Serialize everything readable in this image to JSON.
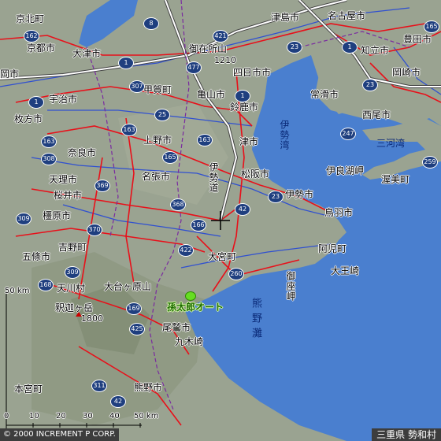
{
  "map": {
    "cities": [
      {
        "name": "京北町"
      },
      {
        "name": "京都市"
      },
      {
        "name": "大津市"
      },
      {
        "name": "宇治市"
      },
      {
        "name": "枚方市"
      },
      {
        "name": "奈良市"
      },
      {
        "name": "天理市"
      },
      {
        "name": "桜井市"
      },
      {
        "name": "橿原市"
      },
      {
        "name": "五條市"
      },
      {
        "name": "吉野町"
      },
      {
        "name": "天川村"
      },
      {
        "name": "釈迦ヶ岳"
      },
      {
        "name": "本宮町"
      },
      {
        "name": "甲賀町"
      },
      {
        "name": "亀山市"
      },
      {
        "name": "鈴鹿市"
      },
      {
        "name": "四日市市"
      },
      {
        "name": "御在所山"
      },
      {
        "name": "津島市"
      },
      {
        "name": "名古屋市"
      },
      {
        "name": "豊田市"
      },
      {
        "name": "知立市"
      },
      {
        "name": "岡崎市"
      },
      {
        "name": "常滑市"
      },
      {
        "name": "西尾市"
      },
      {
        "name": "上野市"
      },
      {
        "name": "名張市"
      },
      {
        "name": "津市"
      },
      {
        "name": "松阪市"
      },
      {
        "name": "伊勢市"
      },
      {
        "name": "鳥羽市"
      },
      {
        "name": "伊良湖岬"
      },
      {
        "name": "渥美町"
      },
      {
        "name": "大宮町"
      },
      {
        "name": "阿児町"
      },
      {
        "name": "大王崎"
      },
      {
        "name": "大台ヶ原山"
      },
      {
        "name": "尾鷲市"
      },
      {
        "name": "九木崎"
      },
      {
        "name": "熊野市"
      },
      {
        "name": "岡市"
      },
      {
        "name": "木市"
      }
    ],
    "sea_labels": [
      {
        "name": "伊勢湾"
      },
      {
        "name": "三河湾"
      },
      {
        "name": "熊野灘"
      },
      {
        "name": "御座岬"
      },
      {
        "name": "伊勢道"
      }
    ],
    "elevations": [
      {
        "value": "1210"
      },
      {
        "value": "1800"
      }
    ],
    "route_shields": [
      "162",
      "1",
      "477",
      "307",
      "1",
      "25",
      "163",
      "163",
      "165",
      "163",
      "308",
      "369",
      "309",
      "370",
      "168",
      "309",
      "169",
      "425",
      "311",
      "42",
      "166",
      "368",
      "422",
      "260",
      "42",
      "23",
      "1",
      "421",
      "23",
      "1",
      "247",
      "23",
      "259",
      "8",
      "165",
      "42",
      "1"
    ],
    "poi": {
      "name": "孫太郎オート"
    },
    "scale": {
      "top_label": "50 km",
      "bottom_labels": [
        "0",
        "10",
        "20",
        "30",
        "40",
        "50 km"
      ]
    },
    "copyright": "© 2000 INCREMENT P CORP.",
    "region": "三重県 勢和村",
    "colors": {
      "land": "#9aa391",
      "sea": "#4a7fcf",
      "lake": "#4a7fcf",
      "road_red": "#e8101a",
      "road_blue": "#3050d0",
      "road_white": "#ffffff",
      "poi": "#66dd22"
    }
  }
}
